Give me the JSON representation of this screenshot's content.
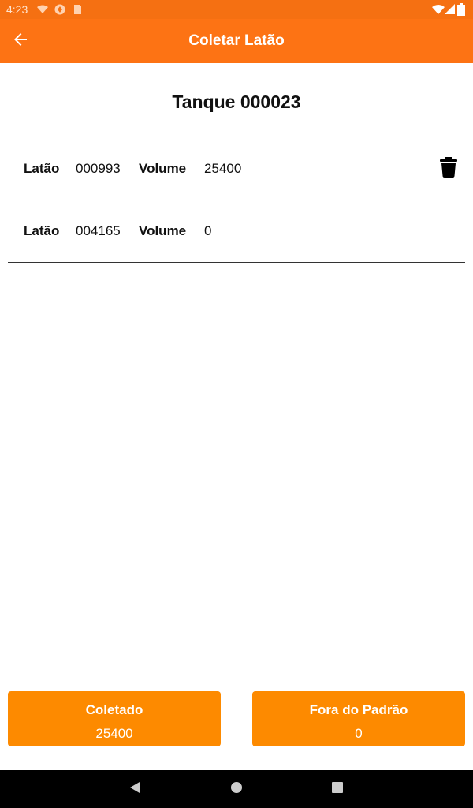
{
  "status_bar": {
    "time": "4:23"
  },
  "app_bar": {
    "title": "Coletar Latão",
    "back_icon": "arrow-left-icon"
  },
  "tank": {
    "title": "Tanque 000023"
  },
  "items": [
    {
      "latao_label": "Latão",
      "latao_value": "000993",
      "volume_label": "Volume",
      "volume_value": "25400",
      "delete_icon": "trash-icon"
    },
    {
      "latao_label": "Latão",
      "latao_value": "004165",
      "volume_label": "Volume",
      "volume_value": "0"
    }
  ],
  "summary": {
    "coletado_label": "Coletado",
    "coletado_value": "25400",
    "fora_label": "Fora do Padrão",
    "fora_value": "0"
  },
  "colors": {
    "status_bar": "#f57012",
    "app_bar": "#fd7314",
    "summary_button": "#fd8a00"
  }
}
